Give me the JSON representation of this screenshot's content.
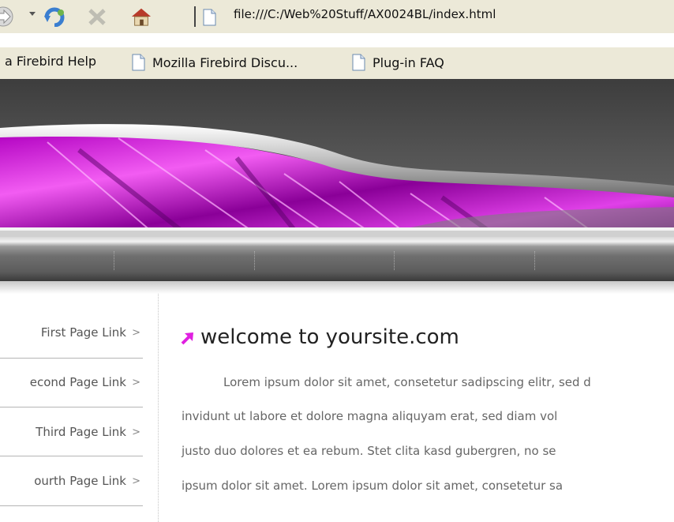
{
  "browser": {
    "url": "file:///C:/Web%20Stuff/AX0024BL/index.html",
    "icons": [
      "forward-arrow-icon",
      "dropdown-icon",
      "reload-icon",
      "stop-icon",
      "home-icon",
      "page-icon"
    ]
  },
  "bookmarks": [
    {
      "label": "a Firebird Help"
    },
    {
      "label": "Mozilla Firebird Discu..."
    },
    {
      "label": "Plug-in FAQ"
    }
  ],
  "sidebar": {
    "items": [
      {
        "label": "First Page Link"
      },
      {
        "label": "econd Page Link"
      },
      {
        "label": "Third Page Link"
      },
      {
        "label": "ourth Page Link"
      }
    ],
    "arrow": ">"
  },
  "main": {
    "title": "welcome to yoursite.com",
    "paragraph": [
      "Lorem ipsum dolor sit amet, consetetur sadipscing elitr, sed d",
      "invidunt ut labore et dolore magna aliquyam erat, sed diam vol",
      "justo duo dolores et ea rebum. Stet clita kasd gubergren, no se",
      "ipsum dolor sit amet. Lorem ipsum dolor sit amet, consetetur sa"
    ]
  },
  "colors": {
    "accent": "#e020e0",
    "header_dark": "#4a4a4a",
    "link_text": "#555555"
  }
}
